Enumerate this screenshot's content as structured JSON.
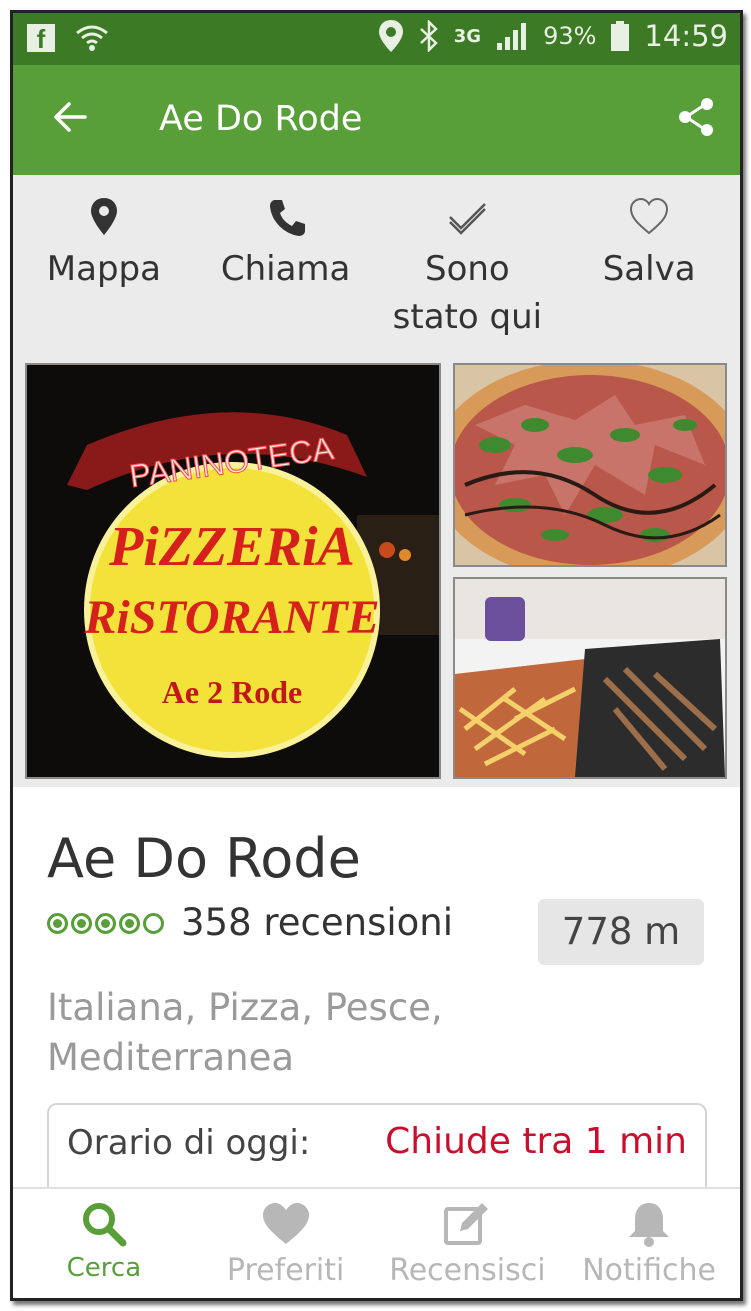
{
  "status_bar": {
    "network": "3G",
    "battery": "93%",
    "time": "14:59"
  },
  "header": {
    "title": "Ae Do Rode"
  },
  "actions": [
    {
      "label": "Mappa"
    },
    {
      "label": "Chiama"
    },
    {
      "label_line1": "Sono",
      "label_line2": "stato qui"
    },
    {
      "label": "Salva"
    }
  ],
  "photo_sign": {
    "line1": "PANINOTECA",
    "line2": "PiZZERiA",
    "line3": "RiSTORANTE",
    "line4": "Ae 2 Rode"
  },
  "restaurant": {
    "name": "Ae Do Rode",
    "rating": 4,
    "rating_max": 5,
    "reviews": "358 recensioni",
    "distance": "778 m",
    "cuisine": "Italiana, Pizza, Pesce, Mediterranea"
  },
  "hours": {
    "label": "Orario di oggi:",
    "value": "Chiude tra 1 min"
  },
  "tabs": [
    {
      "label": "Cerca",
      "icon": "search-icon",
      "active": true
    },
    {
      "label": "Preferiti",
      "icon": "heart-icon"
    },
    {
      "label": "Recensisci",
      "icon": "edit-icon"
    },
    {
      "label": "Notifiche",
      "icon": "bell-icon"
    }
  ],
  "colors": {
    "brand": "#589f3a",
    "status_bar": "#3d7a25",
    "alert": "#c8102e"
  }
}
